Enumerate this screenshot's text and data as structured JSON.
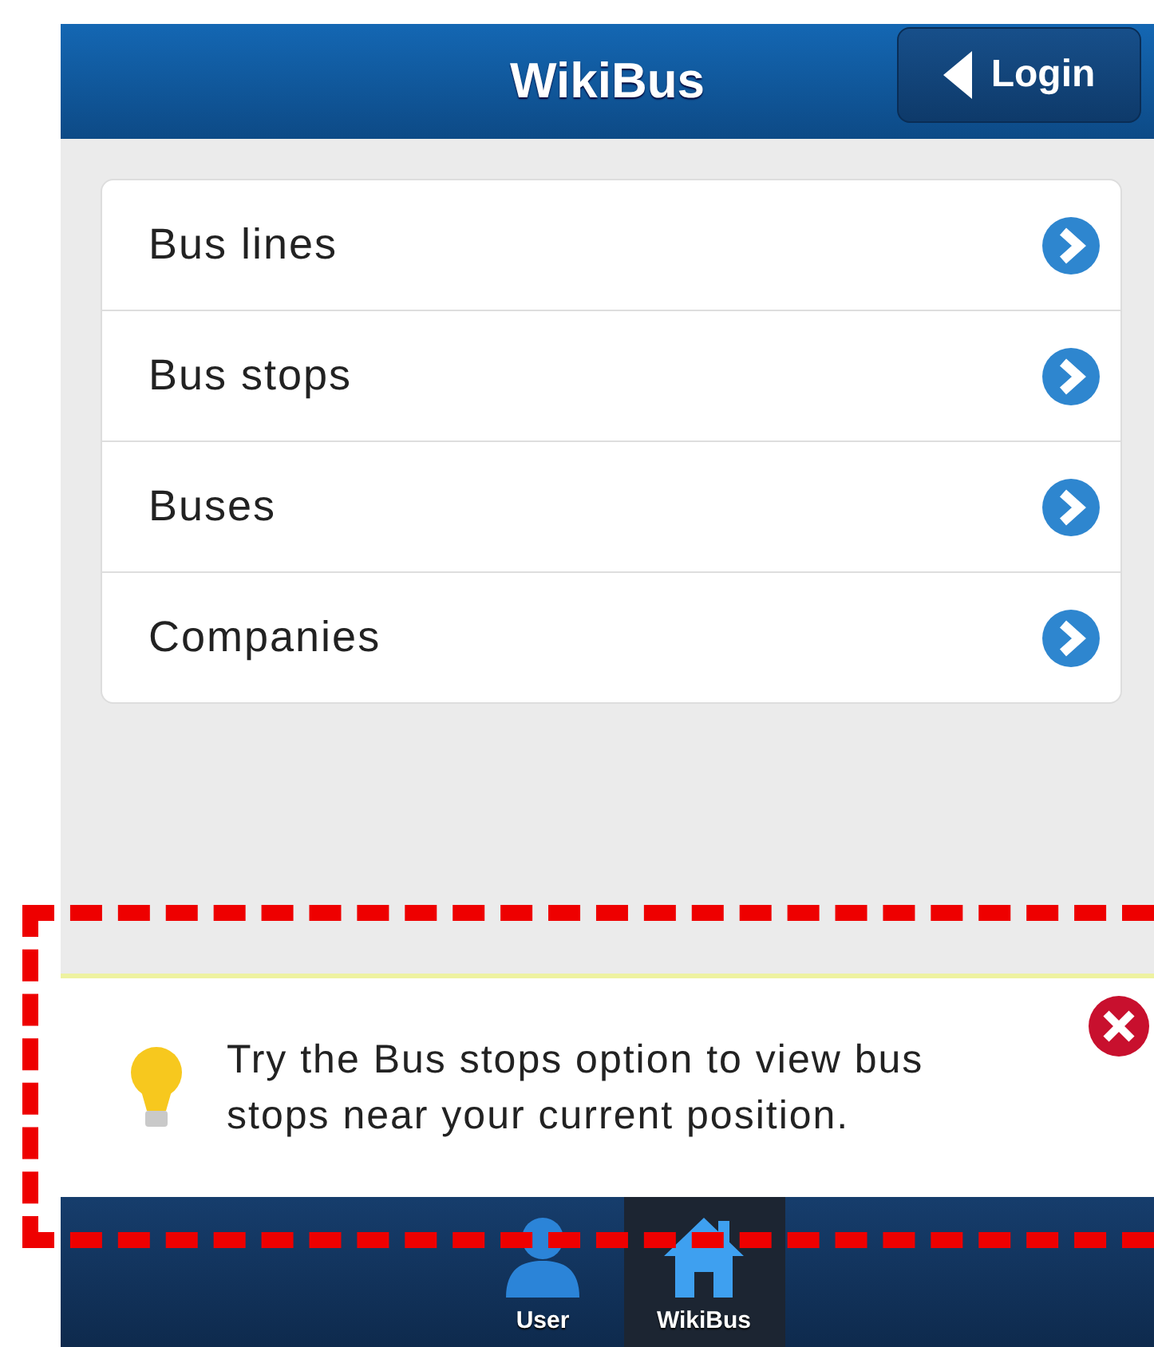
{
  "header": {
    "title": "WikiBus",
    "back_button": "Login"
  },
  "menu": [
    {
      "label": "Bus lines"
    },
    {
      "label": "Bus stops"
    },
    {
      "label": "Buses"
    },
    {
      "label": "Companies"
    }
  ],
  "tip": {
    "text": "Try the Bus stops option to view bus stops near your current position."
  },
  "tabs": [
    {
      "label": "User",
      "kind": "user",
      "selected": false
    },
    {
      "label": "WikiBus",
      "kind": "home",
      "selected": true
    }
  ]
}
